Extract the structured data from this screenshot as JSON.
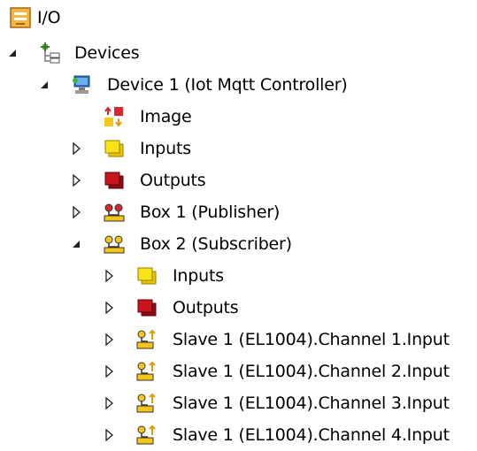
{
  "tree": {
    "io": {
      "label": "I/O",
      "icon": "io-folder-icon",
      "expanded": true
    },
    "devices": {
      "label": "Devices",
      "icon": "devices-icon",
      "expanded": true
    },
    "device1": {
      "label": "Device 1 (Iot Mqtt Controller)",
      "icon": "network-device-icon",
      "expanded": true
    },
    "image": {
      "label": "Image",
      "icon": "image-icon"
    },
    "inputs": {
      "label": "Inputs",
      "icon": "inputs-icon",
      "expanded": false
    },
    "outputs": {
      "label": "Outputs",
      "icon": "outputs-icon",
      "expanded": false
    },
    "box1": {
      "label": "Box 1 (Publisher)",
      "icon": "box-icon",
      "expanded": false
    },
    "box2": {
      "label": "Box 2 (Subscriber)",
      "icon": "box-icon",
      "expanded": true,
      "children": [
        {
          "label": "Inputs",
          "icon": "inputs-icon",
          "expanded": false
        },
        {
          "label": "Outputs",
          "icon": "outputs-icon",
          "expanded": false
        },
        {
          "label": "Slave 1 (EL1004).Channel 1.Input",
          "icon": "variable-input-icon",
          "expanded": false
        },
        {
          "label": "Slave 1 (EL1004).Channel 2.Input",
          "icon": "variable-input-icon",
          "expanded": false
        },
        {
          "label": "Slave 1 (EL1004).Channel 3.Input",
          "icon": "variable-input-icon",
          "expanded": false
        },
        {
          "label": "Slave 1 (EL1004).Channel 4.Input",
          "icon": "variable-input-icon",
          "expanded": false
        }
      ]
    }
  },
  "colors": {
    "inputs_yellow": "#f7e318",
    "outputs_red": "#c8141e",
    "io_orange": "#f0a030"
  }
}
